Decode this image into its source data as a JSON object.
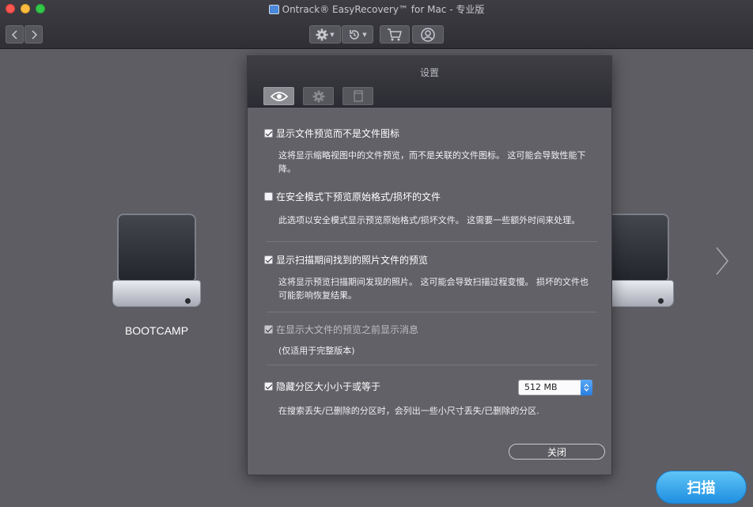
{
  "window": {
    "title": "Ontrack® EasyRecovery™ for Mac - 专业版"
  },
  "toolbar": {
    "back_icon": "chevron-left-icon",
    "forward_icon": "chevron-right-icon",
    "settings_icon": "gear-icon",
    "history_icon": "history-icon",
    "cart_icon": "cart-icon",
    "account_icon": "user-icon"
  },
  "drives": [
    {
      "label": "BOOTCAMP"
    },
    {
      "label": ""
    }
  ],
  "scan_button": {
    "label": "扫描"
  },
  "dialog": {
    "title": "设置",
    "tabs": [
      {
        "icon": "eye-icon",
        "selected": true
      },
      {
        "icon": "gear-icon",
        "selected": false
      },
      {
        "icon": "document-icon",
        "selected": false
      }
    ],
    "options": [
      {
        "label": "显示文件预览而不是文件图标",
        "checked": true,
        "enabled": true,
        "description": "这将显示缩略视图中的文件预览，而不是关联的文件图标。 这可能会导致性能下降。"
      },
      {
        "label": "在安全模式下预览原始格式/损坏的文件",
        "checked": false,
        "enabled": true,
        "description": "此选项以安全模式显示预览原始格式/损坏文件。 这需要一些额外时间来处理。"
      },
      {
        "label": "显示扫描期间找到的照片文件的预览",
        "checked": true,
        "enabled": true,
        "description": "这将显示预览扫描期间发现的照片。 这可能会导致扫描过程变慢。 损坏的文件也可能影响恢复结果。"
      },
      {
        "label": "在显示大文件的预览之前显示消息",
        "checked": true,
        "enabled": false,
        "description": "(仅适用于完整版本)"
      },
      {
        "label": "隐藏分区大小小于或等于",
        "checked": true,
        "enabled": true,
        "description": "在搜索丢失/已删除的分区时，会列出一些小尺寸丢失/已删除的分区."
      }
    ],
    "size_select": {
      "value": "512 MB"
    },
    "close_label": "关闭"
  },
  "colors": {
    "background": "#5e5d63",
    "titlebar": "#2f2f35",
    "accent": "#2a8de6"
  }
}
